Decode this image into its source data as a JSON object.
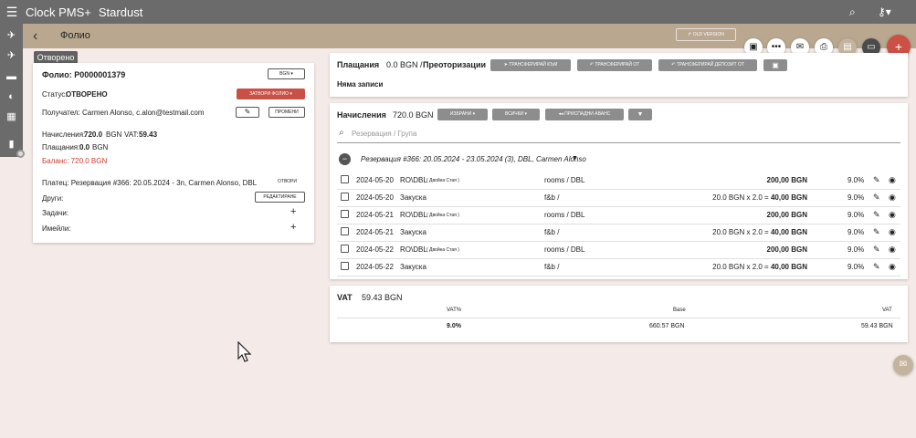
{
  "app": {
    "name": "Clock PMS+",
    "property": "Stardust"
  },
  "page": {
    "title": "Фолио",
    "old_version": "OLD VERSION"
  },
  "tooltip": "Отворено",
  "folio": {
    "heading": "Фолио: P0000001379",
    "currency": "BGN",
    "status_label": "Статус:",
    "status_value": "ОТВОРЕНО",
    "close_btn": "ЗАТВОРИ ФОЛИО",
    "recipient": "Получател: Carmen Alonso, c.alon@testmail.com",
    "change_btn": "ПРОМЕНИ",
    "charges_label": "Начисления:",
    "charges_value": "720.0",
    "charges_cur": "BGN",
    "vat_label": "VAT:",
    "vat_value": "59.43",
    "payments_label": "Плащания:",
    "payments_value": "0.0",
    "payments_cur": "BGN",
    "balance": "Баланс: 720.0 BGN",
    "payer": "Платец: Резервация #366: 20.05.2024 - 3n, Carmen Alonso, DBL",
    "open_btn": "ОТВОРИ",
    "others_label": "Други:",
    "edit_btn": "РЕДАКТИРАНЕ",
    "tasks_label": "Задачи:",
    "emails_label": "Имейли:"
  },
  "payments": {
    "title": "Плащания",
    "summary": "0.0 BGN /",
    "pre_auth": "Преоторизации",
    "btn_transfer_to": "ТРАНСФЕРИРАЙ КЪМ",
    "btn_transfer_from": "ТРАНСФЕРИРАЙ ОТ",
    "btn_transfer_deposit": "ТРАНСФЕРИРАЙ ДЕПОЗИТ ОТ",
    "empty": "Няма записи"
  },
  "charges": {
    "title": "Начисления",
    "amount": "720.0 BGN",
    "btn_selected": "ИЗБРАНИ",
    "btn_all": "ВСИЧКИ",
    "btn_advance": "ПРИСПАДНИ АВАНС",
    "search_placeholder": "Резервация / Група",
    "group_label": "Резервация #366: 20.05.2024 - 23.05.2024 (3), DBL, Carmen Alonso",
    "rows": [
      {
        "date": "2024-05-20",
        "name": "RO\\DBL",
        "sub": "( Двойна Стая )",
        "cat": "rooms / DBL",
        "calc": "",
        "total": "200,00 BGN",
        "vat": "9.0%"
      },
      {
        "date": "2024-05-20",
        "name": "Закуска",
        "sub": "",
        "cat": "f&b /",
        "calc": "20.0 BGN x 2.0 =",
        "total": "40,00 BGN",
        "vat": "9.0%"
      },
      {
        "date": "2024-05-21",
        "name": "RO\\DBL",
        "sub": "( Двойна Стая )",
        "cat": "rooms / DBL",
        "calc": "",
        "total": "200,00 BGN",
        "vat": "9.0%"
      },
      {
        "date": "2024-05-21",
        "name": "Закуска",
        "sub": "",
        "cat": "f&b /",
        "calc": "20.0 BGN x 2.0 =",
        "total": "40,00 BGN",
        "vat": "9.0%"
      },
      {
        "date": "2024-05-22",
        "name": "RO\\DBL",
        "sub": "( Двойна Стая )",
        "cat": "rooms / DBL",
        "calc": "",
        "total": "200,00 BGN",
        "vat": "9.0%"
      },
      {
        "date": "2024-05-22",
        "name": "Закуска",
        "sub": "",
        "cat": "f&b /",
        "calc": "20.0 BGN x 2.0 =",
        "total": "40,00 BGN",
        "vat": "9.0%"
      }
    ]
  },
  "vat": {
    "title": "VAT",
    "amount": "59.43 BGN",
    "headers": {
      "rate": "VAT%",
      "base": "Base",
      "vat": "VAT"
    },
    "row": {
      "rate": "9.0%",
      "base": "660.57 BGN",
      "vat": "59.43 BGN"
    }
  },
  "icons": {
    "menu": "hamburger-icon",
    "search": "search-icon",
    "key": "key-icon",
    "qr": "qr-icon",
    "more": "more-icon",
    "mail": "mail-icon",
    "print": "print-icon",
    "invoice": "invoice-icon",
    "card": "card-icon",
    "add": "add-icon"
  }
}
